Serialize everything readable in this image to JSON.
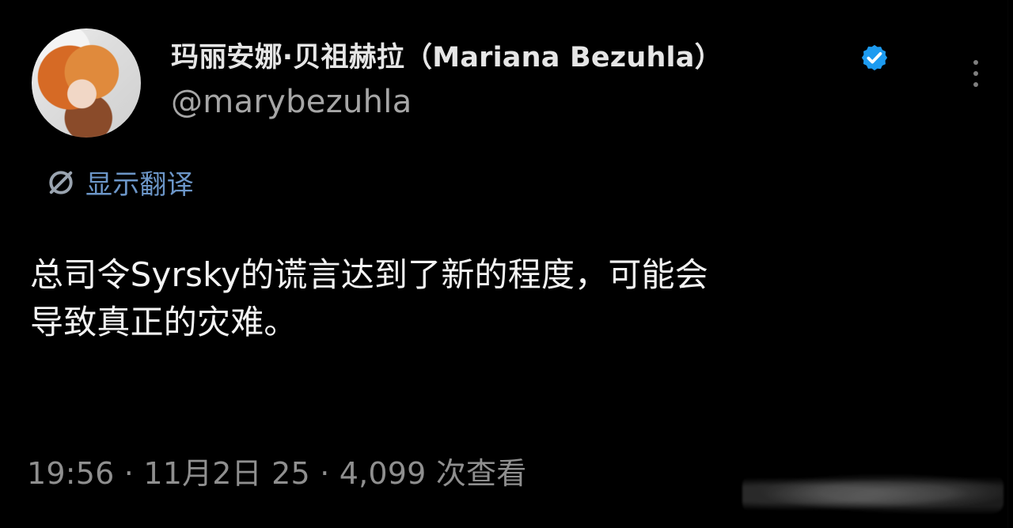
{
  "tweet": {
    "display_name": "玛丽安娜·贝祖赫拉（Mariana Bezuhla）",
    "handle": "@marybezuhla",
    "translate_label": "显示翻译",
    "body_lines": [
      "总司令Syrsky的谎言达到了新的程度，可能会",
      "导致真正的灾难。"
    ],
    "meta_line": "19:56 · 11月2日 25 · 4,099 次查看"
  },
  "icons": {
    "verified": "verified-badge-icon",
    "more": "more-options-icon",
    "translate": "translate-icon"
  },
  "colors": {
    "background": "#000000",
    "text_primary": "#e6e6e6",
    "text_secondary": "#a6a6a6",
    "link_blue": "#6c96c8",
    "verified_blue": "#1d9bf0"
  }
}
